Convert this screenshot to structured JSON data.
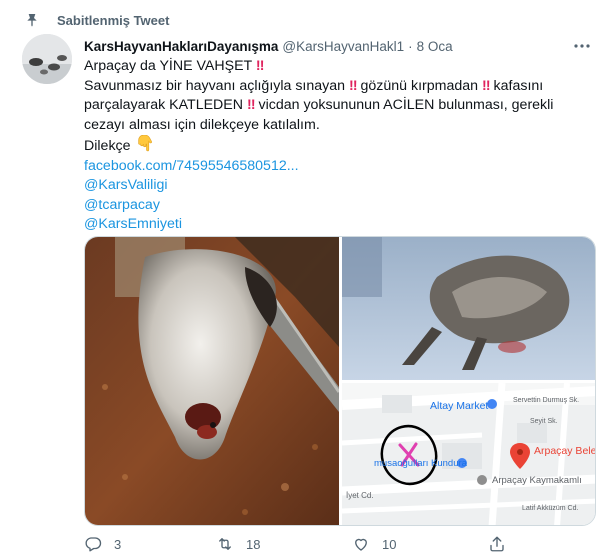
{
  "pinned": {
    "label": "Sabitlenmiş Tweet"
  },
  "tweet": {
    "display_name": "KarsHayvanHaklarıDayanışma",
    "handle": "@KarsHayvanHakl1",
    "separator": "·",
    "date": "8 Oca",
    "line1": "Arpaçay da YİNE VAHŞET",
    "line2a": "Savunmasız bir hayvanı açlığıyla sınayan",
    "line2b": "gözünü kırpmadan",
    "line2c": "kafasını",
    "line3a": "parçalayarak KATLEDEN",
    "line3b": "vicdan yoksununun ACİLEN bulunması, gerekli",
    "line4": "cezayı alması için dilekçeye katılalım.",
    "line5": "Dilekçe",
    "link_facebook": "facebook.com/74595546580512...",
    "mention1": "@KarsValiligi",
    "mention2": "@tcarpacay",
    "mention3": "@KarsEmniyeti",
    "bang": "‼"
  },
  "map": {
    "altay": "Altay Market",
    "servettin": "Servettin Durmuş Sk.",
    "seyit": "Seyit Sk.",
    "arpacay_bele": "Arpaçay Bele",
    "musaoglu": "musaoğulları Kundura",
    "iyet": "İyet Cd.",
    "kaymakam": "Arpaçay Kaymakamlı",
    "latif": "Latif Akküzüm Cd."
  },
  "actions": {
    "reply_count": "3",
    "retweet_count": "18",
    "like_count": "10"
  },
  "colors": {
    "link": "#1b95e0",
    "muted": "#536471",
    "bang": "#e0245e",
    "marker_x": "#e040b0",
    "map_pin": "#ea4335"
  }
}
